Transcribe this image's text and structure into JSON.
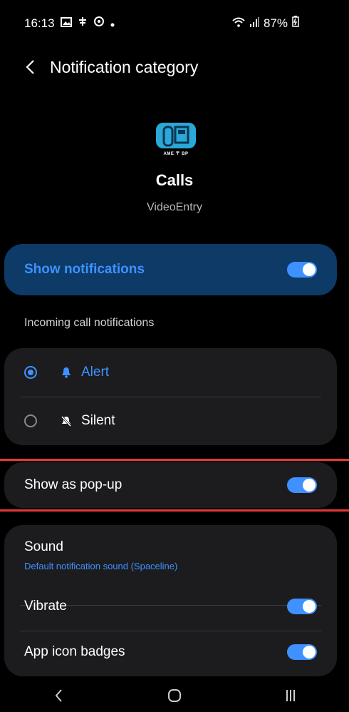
{
  "status_bar": {
    "time": "16:13",
    "battery": "87%",
    "icons_left": [
      "gallery-icon",
      "nfc-icon",
      "sync-icon",
      "dot-icon"
    ],
    "icons_right": [
      "wifi-icon",
      "signal-icon",
      "battery-icon"
    ]
  },
  "header": {
    "title": "Notification category"
  },
  "app": {
    "name": "Calls",
    "package": "VideoEntry",
    "icon_text": "AME 〒 BP"
  },
  "show_notifications": {
    "label": "Show notifications",
    "enabled": true
  },
  "incoming": {
    "section_label": "Incoming call notifications",
    "options": [
      {
        "label": "Alert",
        "selected": true,
        "icon": "bell-icon"
      },
      {
        "label": "Silent",
        "selected": false,
        "icon": "bell-off-icon"
      }
    ]
  },
  "popup": {
    "label": "Show as pop-up",
    "enabled": true
  },
  "sound": {
    "title": "Sound",
    "value": "Default notification sound (Spaceline)"
  },
  "vibrate": {
    "label": "Vibrate",
    "enabled": true
  },
  "badges": {
    "label": "App icon badges",
    "enabled": true
  },
  "colors": {
    "accent": "#3e91ff",
    "highlight_bg": "#0d3a66",
    "card_bg": "#1c1c1e",
    "annotation": "#e53935"
  }
}
